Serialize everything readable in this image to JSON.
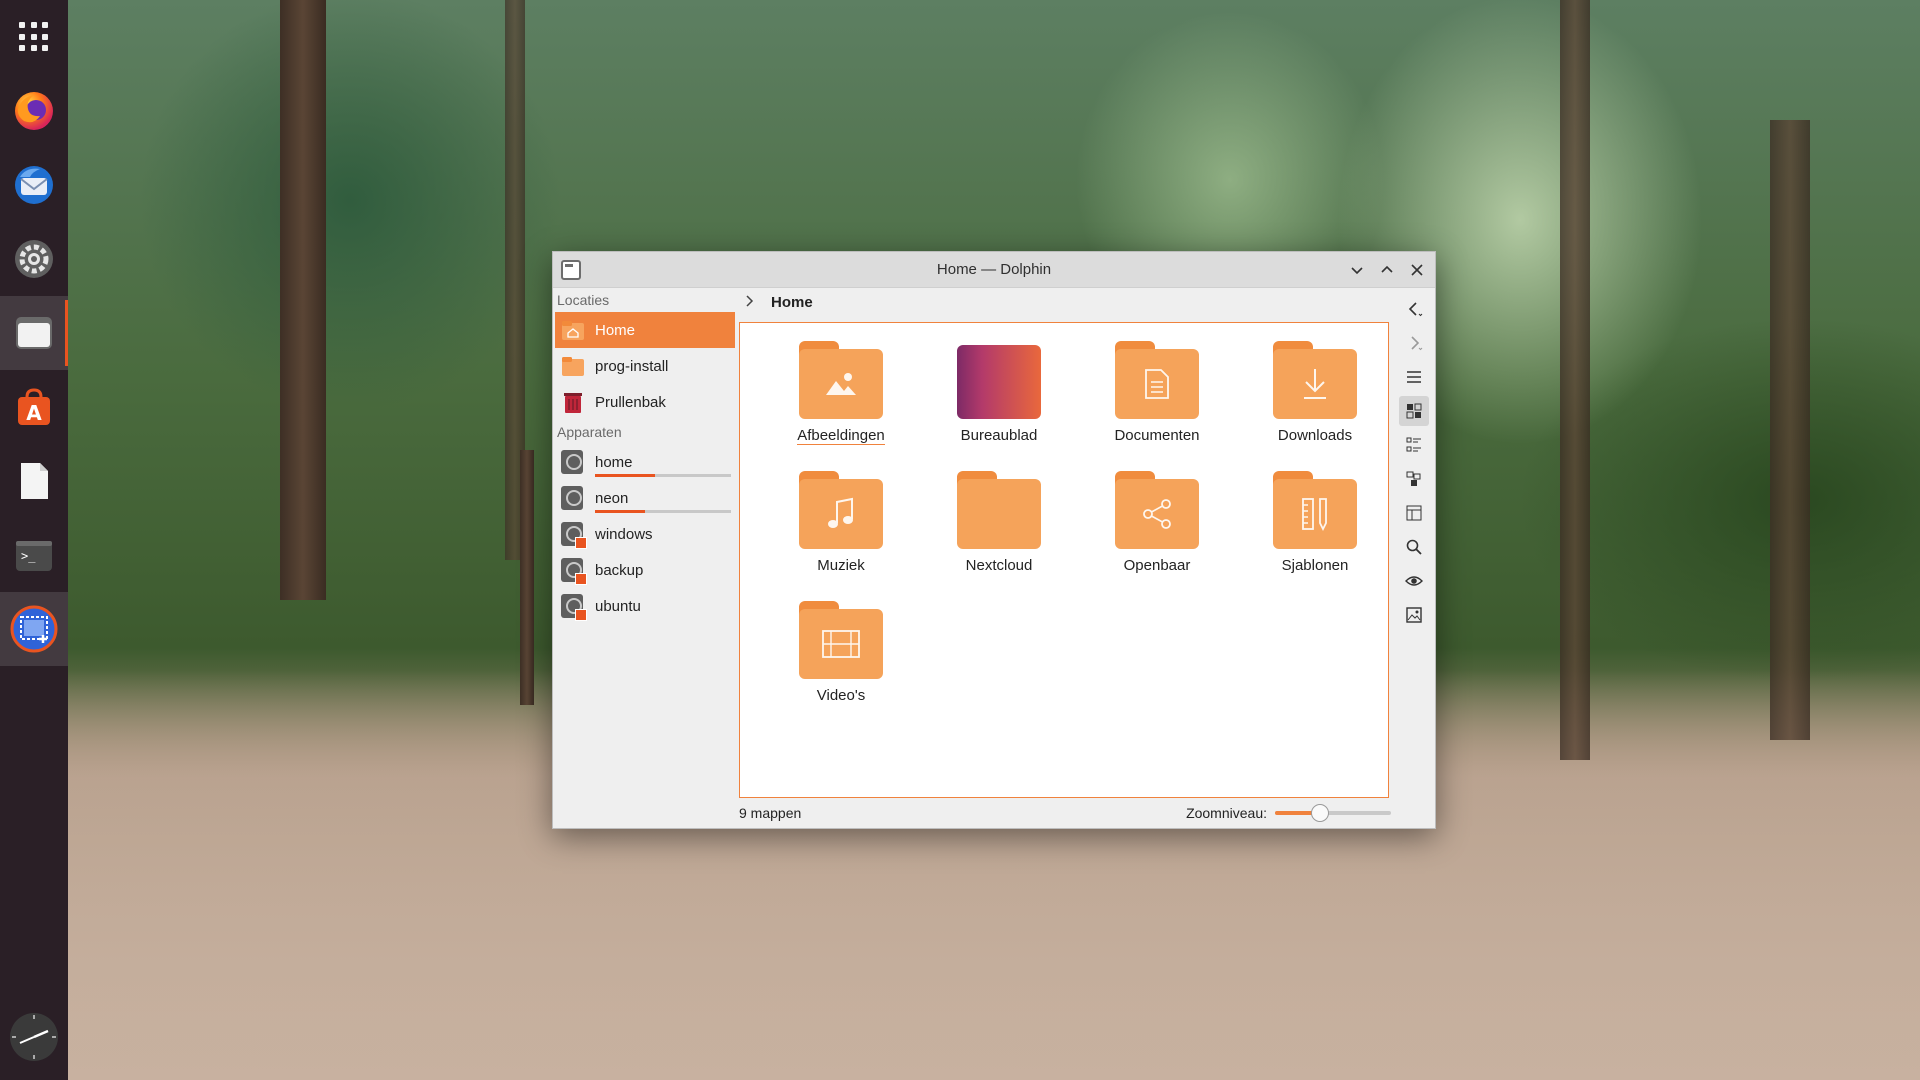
{
  "dock": {
    "items": [
      {
        "name": "app-grid-icon"
      },
      {
        "name": "firefox-icon"
      },
      {
        "name": "thunderbird-icon"
      },
      {
        "name": "settings-icon"
      },
      {
        "name": "files-icon"
      },
      {
        "name": "app-center-icon"
      },
      {
        "name": "text-editor-icon"
      },
      {
        "name": "terminal-icon"
      },
      {
        "name": "screenshot-icon"
      }
    ],
    "bottom": "clock-icon"
  },
  "window": {
    "title": "Home — Dolphin",
    "buttons": [
      "minimize",
      "maximize",
      "close"
    ]
  },
  "sidebar": {
    "section_places": "Locaties",
    "places": [
      {
        "label": "Home",
        "icon": "home-folder-icon",
        "selected": true
      },
      {
        "label": "prog-install",
        "icon": "folder-icon"
      },
      {
        "label": "Prullenbak",
        "icon": "trash-icon"
      }
    ],
    "section_devices": "Apparaten",
    "devices": [
      {
        "label": "home",
        "icon": "drive-icon",
        "usage": 0.44
      },
      {
        "label": "neon",
        "icon": "drive-icon",
        "usage": 0.37
      },
      {
        "label": "windows",
        "icon": "drive-mounted-icon"
      },
      {
        "label": "backup",
        "icon": "drive-mounted-icon"
      },
      {
        "label": "ubuntu",
        "icon": "drive-mounted-icon"
      }
    ]
  },
  "breadcrumb": {
    "current": "Home"
  },
  "folders": [
    {
      "label": "Afbeeldingen",
      "icon": "pictures-folder-icon"
    },
    {
      "label": "Bureaublad",
      "icon": "desktop-folder-icon"
    },
    {
      "label": "Documenten",
      "icon": "documents-folder-icon"
    },
    {
      "label": "Downloads",
      "icon": "downloads-folder-icon"
    },
    {
      "label": "Muziek",
      "icon": "music-folder-icon"
    },
    {
      "label": "Nextcloud",
      "icon": "folder-icon"
    },
    {
      "label": "Openbaar",
      "icon": "public-share-folder-icon"
    },
    {
      "label": "Sjablonen",
      "icon": "templates-folder-icon"
    },
    {
      "label": "Video's",
      "icon": "videos-folder-icon"
    }
  ],
  "status": {
    "count": "9 mappen",
    "zoom_label": "Zoomniveau:",
    "zoom_level": 0.39
  },
  "colors": {
    "accent": "#f0823d",
    "ubuntu_orange": "#e95420",
    "folder": "#f5a35a",
    "folder_tab": "#f08c3e",
    "dock_bg": "#2a1f26"
  }
}
